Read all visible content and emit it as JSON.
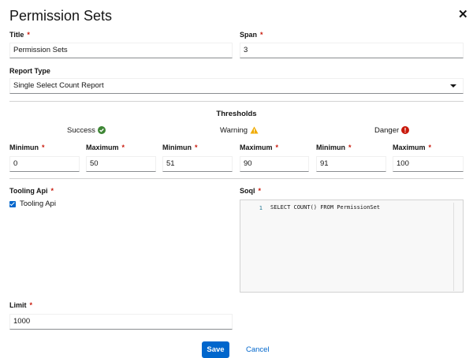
{
  "modal": {
    "title": "Permission Sets"
  },
  "fields": {
    "title": {
      "label": "Title",
      "value": "Permission Sets"
    },
    "span": {
      "label": "Span",
      "value": "3"
    },
    "report_type": {
      "label": "Report Type",
      "value": "Single Select Count Report"
    }
  },
  "thresholds": {
    "heading": "Thresholds",
    "success": {
      "label": "Success",
      "color": "#3e8635",
      "icon": "check-circle-icon"
    },
    "warning": {
      "label": "Warning",
      "color": "#f0ab00",
      "icon": "warning-triangle-icon"
    },
    "danger": {
      "label": "Danger",
      "color": "#c9190b",
      "icon": "exclamation-circle-icon"
    },
    "inputs": [
      {
        "label": "Minimun",
        "value": "0"
      },
      {
        "label": "Maximum",
        "value": "50"
      },
      {
        "label": "Minimun",
        "value": "51"
      },
      {
        "label": "Maximum",
        "value": "90"
      },
      {
        "label": "Minimun",
        "value": "91"
      },
      {
        "label": "Maximum",
        "value": "100"
      }
    ]
  },
  "tooling_api": {
    "label": "Tooling Api",
    "checkbox_label": "Tooling Api",
    "checked": true
  },
  "soql": {
    "label": "Soql",
    "line_number": "1",
    "code": "SELECT COUNT() FROM PermissionSet"
  },
  "limit": {
    "label": "Limit",
    "value": "1000"
  },
  "actions": {
    "save": "Save",
    "cancel": "Cancel"
  },
  "required_marker": "*"
}
